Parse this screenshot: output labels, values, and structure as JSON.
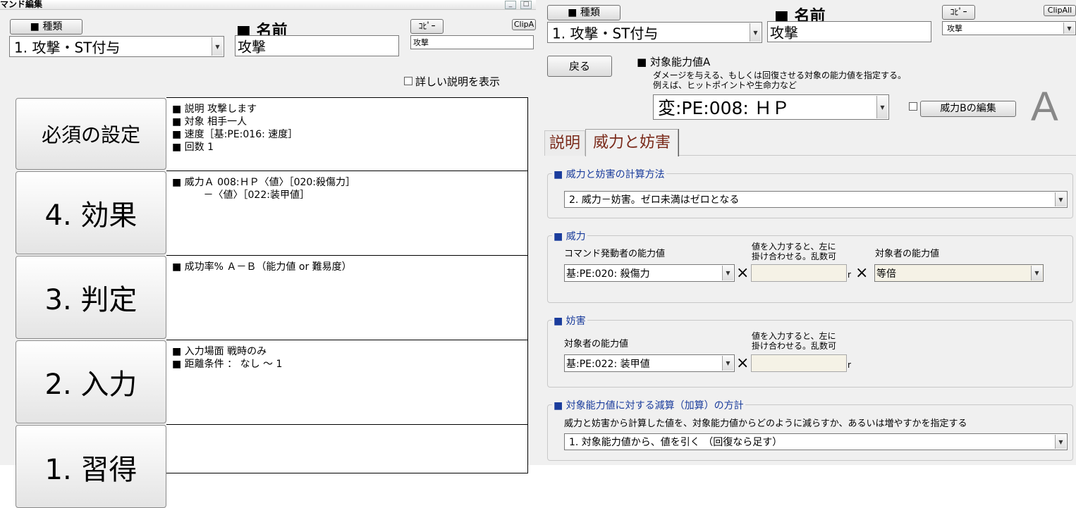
{
  "left": {
    "title": "マンド編集",
    "controls": {
      "minimize": "_",
      "restore": "□"
    },
    "type_button": "■ 種類",
    "type_select": "1. 攻撃・ST付与",
    "name_label": "■ 名前",
    "name_value": "攻撃",
    "copy_button": "ｺﾋﾟｰ",
    "clipall_button": "ClipA",
    "copy_value": "攻撃",
    "detail_checkbox": "詳しい説明を表示",
    "sections": [
      {
        "label": "必須の設定",
        "lines": [
          "■ 説明 攻撃します",
          "■ 対象 相手一人",
          "■ 速度［基:PE:016: 速度］",
          "■ 回数 1"
        ]
      },
      {
        "label": "4. 効果",
        "lines": [
          "■ 威力Ａ 008:ＨＰ〈値〉［020:殺傷力］",
          "          －〈値〉［022:装甲値］"
        ]
      },
      {
        "label": "3. 判定",
        "lines": [
          "■ 成功率% Ａ－Ｂ（能力値 or 難易度）"
        ]
      },
      {
        "label": "2. 入力",
        "lines": [
          "■ 入力場面 戦時のみ",
          "■ 距離条件 ： なし ～ 1"
        ]
      },
      {
        "label": "1. 習得",
        "lines": []
      }
    ]
  },
  "right": {
    "type_button": "■ 種類",
    "type_select": "1. 攻撃・ST付与",
    "name_label": "■ 名前",
    "name_value": "攻撃",
    "copy_button": "ｺﾋﾟｰ",
    "clipall_button": "ClipAll",
    "copy_value": "攻撃",
    "back_button": "戻る",
    "target_label": "■ 対象能力値A",
    "target_desc1": "ダメージを与える、もしくは回復させる対象の能力値を指定する。",
    "target_desc2": "例えば、ヒットポイントや生命力など",
    "target_select": "変:PE:008: ＨＰ",
    "edit_b_button": "威力Bの編集",
    "big_letter": "A",
    "tabs": [
      "説明",
      "威力と妨害"
    ],
    "calc": {
      "title": "■ 威力と妨害の計算方法",
      "select": "2. 威力－妨害。ゼロ未満はゼロとなる"
    },
    "power": {
      "title": "■ 威力",
      "caster_label": "コマンド発動者の能力値",
      "mult_label1": "値を入力すると、左に",
      "mult_label2": "掛け合わせる。乱数可",
      "target_label": "対象者の能力値",
      "caster_select": "基:PE:020: 殺傷力",
      "times": "×",
      "r": "r",
      "target_select": "等倍"
    },
    "defense": {
      "title": "■ 妨害",
      "target_label": "対象者の能力値",
      "mult_label1": "値を入力すると、左に",
      "mult_label2": "掛け合わせる。乱数可",
      "target_select": "基:PE:022: 装甲値",
      "times": "×",
      "r": "r"
    },
    "policy": {
      "title": "■ 対象能力値に対する減算（加算）の方計",
      "desc": "威力と妨害から計算した値を、対象能力値からどのように減らすか、あるいは増やすかを指定する",
      "select": "1. 対象能力値から、値を引く （回復なら足す）"
    }
  }
}
